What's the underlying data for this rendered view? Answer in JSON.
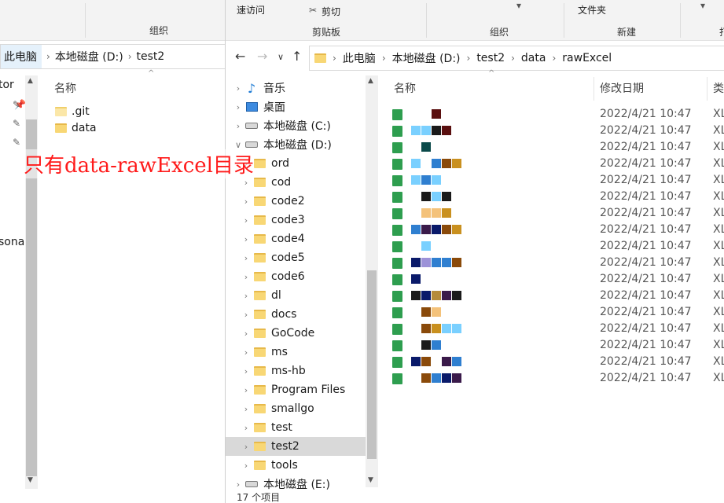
{
  "back_window": {
    "ribbon_group": "组织",
    "address": [
      "此电脑",
      "本地磁盘 (D:)",
      "test2"
    ],
    "nav_partial": [
      "tor",
      "sona"
    ],
    "column_name": "名称",
    "items": [
      {
        "name": ".git",
        "icon": "folder-light-icon"
      },
      {
        "name": "data",
        "icon": "folder-icon"
      }
    ]
  },
  "front_window": {
    "ribbon": {
      "quick_access": "速访问",
      "cut": "剪切",
      "clipboard": "剪贴板",
      "organize": "组织",
      "new_folder": "文件夹",
      "new": "新建",
      "open_partial": "打"
    },
    "address": [
      "此电脑",
      "本地磁盘 (D:)",
      "test2",
      "data",
      "rawExcel"
    ],
    "tree": [
      {
        "label": "音乐",
        "icon": "music-icon",
        "expanded": false
      },
      {
        "label": "桌面",
        "icon": "desktop-icon",
        "expanded": false
      },
      {
        "label": "本地磁盘 (C:)",
        "icon": "drive-icon",
        "expanded": false
      },
      {
        "label": "本地磁盘 (D:)",
        "icon": "drive-icon",
        "expanded": true
      },
      {
        "label": "ord",
        "icon": "folder-icon",
        "expanded": false
      },
      {
        "label": "cod",
        "icon": "folder-icon",
        "expanded": false
      },
      {
        "label": "code2",
        "icon": "folder-icon",
        "expanded": false
      },
      {
        "label": "code3",
        "icon": "folder-icon",
        "expanded": false
      },
      {
        "label": "code4",
        "icon": "folder-icon",
        "expanded": false
      },
      {
        "label": "code5",
        "icon": "folder-icon",
        "expanded": false
      },
      {
        "label": "code6",
        "icon": "folder-icon",
        "expanded": false
      },
      {
        "label": "dl",
        "icon": "folder-icon",
        "expanded": false
      },
      {
        "label": "docs",
        "icon": "folder-icon",
        "expanded": false
      },
      {
        "label": "GoCode",
        "icon": "folder-icon",
        "expanded": false
      },
      {
        "label": "ms",
        "icon": "folder-icon",
        "expanded": false
      },
      {
        "label": "ms-hb",
        "icon": "folder-icon",
        "expanded": false
      },
      {
        "label": "Program Files",
        "icon": "folder-icon",
        "expanded": false
      },
      {
        "label": "smallgo",
        "icon": "folder-icon",
        "expanded": false
      },
      {
        "label": "test",
        "icon": "folder-icon",
        "expanded": false
      },
      {
        "label": "test2",
        "icon": "folder-icon",
        "expanded": false,
        "selected": true
      },
      {
        "label": "tools",
        "icon": "folder-icon",
        "expanded": false
      },
      {
        "label": "本地磁盘 (E:)",
        "icon": "drive-icon",
        "expanded": false
      }
    ],
    "columns": {
      "name": "名称",
      "modified": "修改日期",
      "type": "类"
    },
    "files": [
      {
        "name": "[redacted]",
        "modified": "2022/4/21 10:47",
        "type": "XL"
      },
      {
        "name": "[redacted]",
        "modified": "2022/4/21 10:47",
        "type": "XL"
      },
      {
        "name": "[redacted]",
        "modified": "2022/4/21 10:47",
        "type": "XL"
      },
      {
        "name": "[redacted]",
        "modified": "2022/4/21 10:47",
        "type": "XL"
      },
      {
        "name": "[redacted]",
        "modified": "2022/4/21 10:47",
        "type": "XL"
      },
      {
        "name": "[redacted]",
        "modified": "2022/4/21 10:47",
        "type": "XL"
      },
      {
        "name": "[redacted]",
        "modified": "2022/4/21 10:47",
        "type": "XL"
      },
      {
        "name": "[redacted]",
        "modified": "2022/4/21 10:47",
        "type": "XL"
      },
      {
        "name": "[redacted]",
        "modified": "2022/4/21 10:47",
        "type": "XL"
      },
      {
        "name": "[redacted]",
        "modified": "2022/4/21 10:47",
        "type": "XL"
      },
      {
        "name": "[redacted]",
        "modified": "2022/4/21 10:47",
        "type": "XL"
      },
      {
        "name": "[redacted]",
        "modified": "2022/4/21 10:47",
        "type": "XL"
      },
      {
        "name": "[redacted]",
        "modified": "2022/4/21 10:47",
        "type": "XL"
      },
      {
        "name": "[redacted]",
        "modified": "2022/4/21 10:47",
        "type": "XL"
      },
      {
        "name": "[redacted]",
        "modified": "2022/4/21 10:47",
        "type": "XL"
      },
      {
        "name": "[redacted]",
        "modified": "2022/4/21 10:47",
        "type": "XL"
      },
      {
        "name": "[redacted]",
        "modified": "2022/4/21 10:47",
        "type": "XL"
      }
    ],
    "status": "17 个项目"
  },
  "annotation": "只有data-rawExcel目录",
  "colors": {
    "folder": "#f8d775",
    "excel": "#2e9e4f",
    "annotation": "#ff1a1a",
    "selected": "#d9d9d9"
  }
}
